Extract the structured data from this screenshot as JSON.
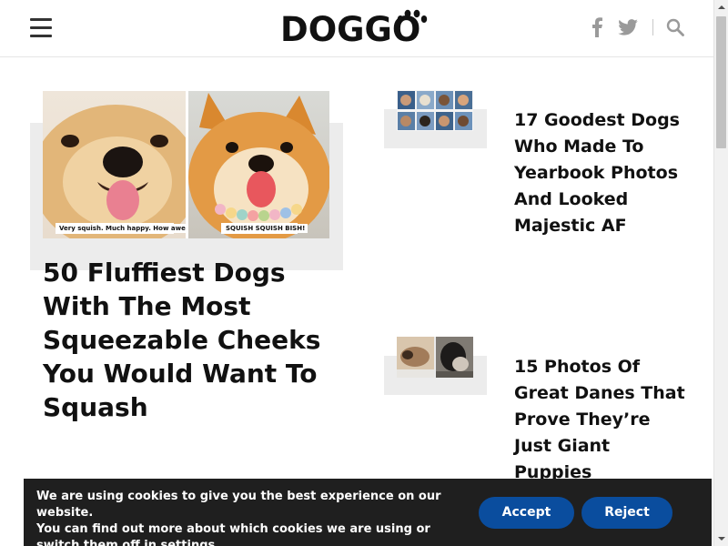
{
  "header": {
    "logo": "DOGGO",
    "menu_icon": "hamburger-menu-icon",
    "facebook_icon": "facebook-icon",
    "twitter_icon": "twitter-icon",
    "search_icon": "search-icon"
  },
  "featured": {
    "title": "50 Fluffiest Dogs With The Most Squeezable Cheeks You Would Want To Squash",
    "image_captions": [
      "Very squish. Much happy. How awesome.",
      "SQUISH SQUISH BISH!"
    ]
  },
  "articles": [
    {
      "title": "17 Goodest Dogs Who Made To Yearbook Photos And Looked Majestic AF"
    },
    {
      "title": "15 Photos Of Great Danes That Prove They’re Just Giant Puppies"
    }
  ],
  "cookie": {
    "line1": "We are using cookies to give you the best experience on our website.",
    "line2": "You can find out more about which cookies we are using or switch them off in",
    "settings_link": "settings",
    "line2_end": ".",
    "accept_label": "Accept",
    "reject_label": "Reject"
  },
  "colors": {
    "button_blue": "#0a4d9e",
    "cookie_bg": "#1f1f1f",
    "card_grey": "#ececec"
  }
}
